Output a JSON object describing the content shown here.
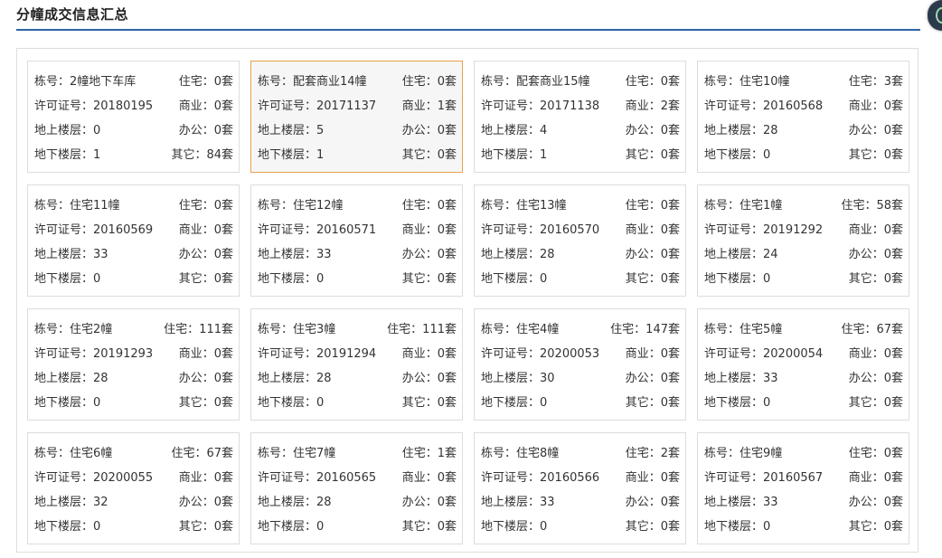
{
  "page_title": "分幢成交信息汇总",
  "accent_color": "#2f63a4",
  "active_color": "#e6a24c",
  "buildings": [
    {
      "building": "栋号：2幢地下车库",
      "residential": "住宅：0套",
      "permit": "许可证号：20180195",
      "commercial": "商业：0套",
      "floors_above": "地上楼层：0",
      "office": "办公：0套",
      "floors_below": "地下楼层：1",
      "other": "其它：84套"
    },
    {
      "building": "栋号：配套商业14幢",
      "residential": "住宅：0套",
      "permit": "许可证号：20171137",
      "commercial": "商业：1套",
      "floors_above": "地上楼层：5",
      "office": "办公：0套",
      "floors_below": "地下楼层：1",
      "other": "其它：0套"
    },
    {
      "building": "栋号：配套商业15幢",
      "residential": "住宅：0套",
      "permit": "许可证号：20171138",
      "commercial": "商业：2套",
      "floors_above": "地上楼层：4",
      "office": "办公：0套",
      "floors_below": "地下楼层：1",
      "other": "其它：0套"
    },
    {
      "building": "栋号：住宅10幢",
      "residential": "住宅：3套",
      "permit": "许可证号：20160568",
      "commercial": "商业：0套",
      "floors_above": "地上楼层：28",
      "office": "办公：0套",
      "floors_below": "地下楼层：0",
      "other": "其它：0套"
    },
    {
      "building": "栋号：住宅11幢",
      "residential": "住宅：0套",
      "permit": "许可证号：20160569",
      "commercial": "商业：0套",
      "floors_above": "地上楼层：33",
      "office": "办公：0套",
      "floors_below": "地下楼层：0",
      "other": "其它：0套"
    },
    {
      "building": "栋号：住宅12幢",
      "residential": "住宅：0套",
      "permit": "许可证号：20160571",
      "commercial": "商业：0套",
      "floors_above": "地上楼层：33",
      "office": "办公：0套",
      "floors_below": "地下楼层：0",
      "other": "其它：0套"
    },
    {
      "building": "栋号：住宅13幢",
      "residential": "住宅：0套",
      "permit": "许可证号：20160570",
      "commercial": "商业：0套",
      "floors_above": "地上楼层：28",
      "office": "办公：0套",
      "floors_below": "地下楼层：0",
      "other": "其它：0套"
    },
    {
      "building": "栋号：住宅1幢",
      "residential": "住宅：58套",
      "permit": "许可证号：20191292",
      "commercial": "商业：0套",
      "floors_above": "地上楼层：24",
      "office": "办公：0套",
      "floors_below": "地下楼层：0",
      "other": "其它：0套"
    },
    {
      "building": "栋号：住宅2幢",
      "residential": "住宅：111套",
      "permit": "许可证号：20191293",
      "commercial": "商业：0套",
      "floors_above": "地上楼层：28",
      "office": "办公：0套",
      "floors_below": "地下楼层：0",
      "other": "其它：0套"
    },
    {
      "building": "栋号：住宅3幢",
      "residential": "住宅：111套",
      "permit": "许可证号：20191294",
      "commercial": "商业：0套",
      "floors_above": "地上楼层：28",
      "office": "办公：0套",
      "floors_below": "地下楼层：0",
      "other": "其它：0套"
    },
    {
      "building": "栋号：住宅4幢",
      "residential": "住宅：147套",
      "permit": "许可证号：20200053",
      "commercial": "商业：0套",
      "floors_above": "地上楼层：30",
      "office": "办公：0套",
      "floors_below": "地下楼层：0",
      "other": "其它：0套"
    },
    {
      "building": "栋号：住宅5幢",
      "residential": "住宅：67套",
      "permit": "许可证号：20200054",
      "commercial": "商业：0套",
      "floors_above": "地上楼层：33",
      "office": "办公：0套",
      "floors_below": "地下楼层：0",
      "other": "其它：0套"
    },
    {
      "building": "栋号：住宅6幢",
      "residential": "住宅：67套",
      "permit": "许可证号：20200055",
      "commercial": "商业：0套",
      "floors_above": "地上楼层：32",
      "office": "办公：0套",
      "floors_below": "地下楼层：0",
      "other": "其它：0套"
    },
    {
      "building": "栋号：住宅7幢",
      "residential": "住宅：1套",
      "permit": "许可证号：20160565",
      "commercial": "商业：0套",
      "floors_above": "地上楼层：28",
      "office": "办公：0套",
      "floors_below": "地下楼层：0",
      "other": "其它：0套"
    },
    {
      "building": "栋号：住宅8幢",
      "residential": "住宅：2套",
      "permit": "许可证号：20160566",
      "commercial": "商业：0套",
      "floors_above": "地上楼层：33",
      "office": "办公：0套",
      "floors_below": "地下楼层：0",
      "other": "其它：0套"
    },
    {
      "building": "栋号：住宅9幢",
      "residential": "住宅：0套",
      "permit": "许可证号：20160567",
      "commercial": "商业：0套",
      "floors_above": "地上楼层：33",
      "office": "办公：0套",
      "floors_below": "地下楼层：0",
      "other": "其它：0套"
    }
  ]
}
